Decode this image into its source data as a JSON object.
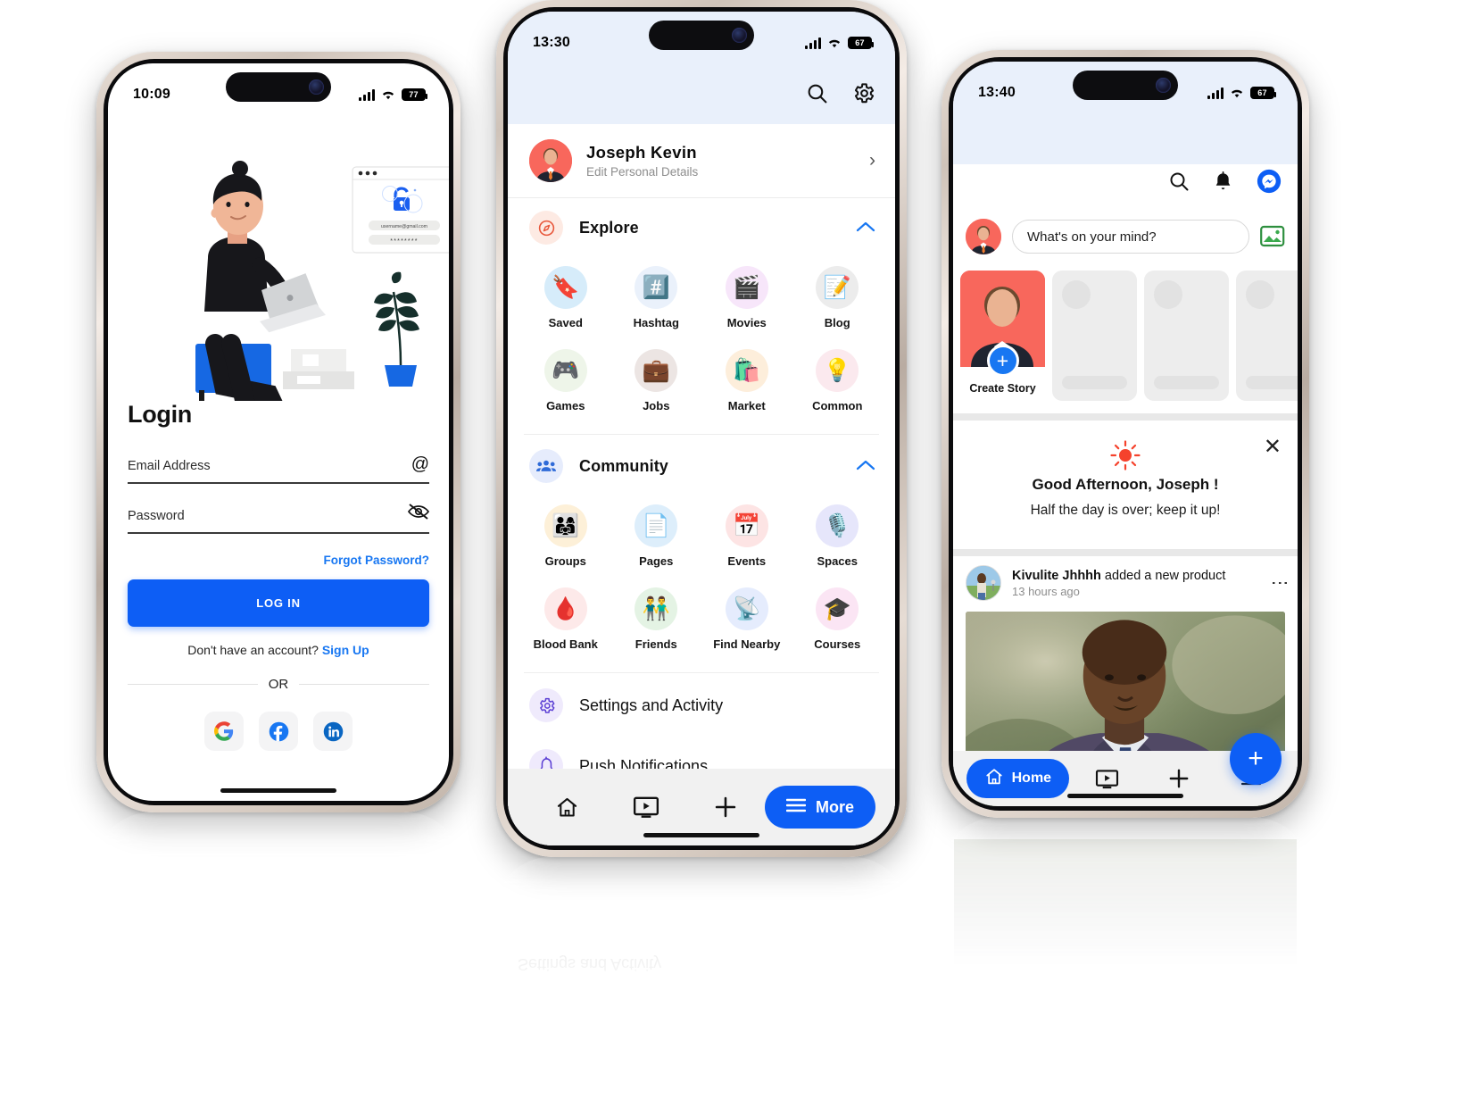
{
  "colors": {
    "primary": "#0d5ef5",
    "link": "#1877f2",
    "status_bar_bg": "#e9f0fb",
    "nav_bg": "#f1f1f1",
    "accent_red": "#f8675c"
  },
  "phone1": {
    "status": {
      "time": "10:09",
      "battery": "77"
    },
    "illustration": {
      "browser_email": "username@gmail.com",
      "browser_password": "********",
      "alt": "person-with-laptop-illustration"
    },
    "title": "Login",
    "email_field": {
      "label": "Email Address",
      "value": "",
      "icon": "at-icon"
    },
    "password_field": {
      "label": "Password",
      "value": "",
      "icon": "eye-off-icon"
    },
    "forgot_password": "Forgot Password?",
    "login_button": "LOG IN",
    "signup_prompt": "Don't have an account? ",
    "signup_link": "Sign Up",
    "or_label": "OR",
    "socials": [
      {
        "name": "google-login-button",
        "icon": "google-icon"
      },
      {
        "name": "facebook-login-button",
        "icon": "facebook-icon"
      },
      {
        "name": "linkedin-login-button",
        "icon": "linkedin-icon"
      }
    ]
  },
  "phone2": {
    "status": {
      "time": "13:30",
      "battery": "67"
    },
    "top_icons": [
      {
        "name": "search-icon",
        "label": "search"
      },
      {
        "name": "gear-icon",
        "label": "settings"
      }
    ],
    "profile": {
      "name": "Joseph  Kevin",
      "subtitle": "Edit Personal Details",
      "chevron": "›"
    },
    "sections": [
      {
        "id": "explore",
        "title": "Explore",
        "icon": "compass-icon",
        "icon_glyph": "🧭",
        "icon_bg": "#fdeae3",
        "collapse_arrow": "⌃",
        "items": [
          {
            "label": "Saved",
            "glyph": "🔖",
            "bg": "#d6ecfa"
          },
          {
            "label": "Hashtag",
            "glyph": "#️⃣",
            "bg": "#eaf1fb"
          },
          {
            "label": "Movies",
            "glyph": "🎬",
            "bg": "#f7e6fa"
          },
          {
            "label": "Blog",
            "glyph": "📝",
            "bg": "#ececec"
          },
          {
            "label": "Games",
            "glyph": "🎮",
            "bg": "#eef5e9"
          },
          {
            "label": "Jobs",
            "glyph": "💼",
            "bg": "#ece5e3"
          },
          {
            "label": "Market",
            "glyph": "🛍️",
            "bg": "#fdeedb"
          },
          {
            "label": "Common",
            "glyph": "💡",
            "bg": "#fbe9ee"
          }
        ]
      },
      {
        "id": "community",
        "title": "Community",
        "icon": "people-icon",
        "icon_glyph": "👥",
        "icon_bg": "#e6ecfc",
        "collapse_arrow": "⌃",
        "items": [
          {
            "label": "Blood Bank",
            "glyph": "🩸",
            "bg": "#fde9e9"
          },
          {
            "label": "Friends",
            "glyph": "👬",
            "bg": "#e4f3e4"
          },
          {
            "label": "Find Nearby",
            "glyph": "📡",
            "bg": "#e5ecfd"
          },
          {
            "label": "Courses",
            "glyph": "🎓",
            "bg": "#fbe5f4"
          },
          {
            "label": "Groups",
            "glyph": "👨‍👩‍👧",
            "bg": "#fdf0d8"
          },
          {
            "label": "Pages",
            "glyph": "📄",
            "bg": "#ddeefb"
          },
          {
            "label": "Events",
            "glyph": "📅",
            "bg": "#fde4e4"
          },
          {
            "label": "Spaces",
            "glyph": "🎙️",
            "bg": "#e6e6fb"
          }
        ]
      }
    ],
    "list_rows": [
      {
        "label": "Settings and Activity",
        "icon": "gear-icon"
      },
      {
        "label": "Push Notifications",
        "icon": "bell-icon"
      }
    ],
    "nav": {
      "items": [
        {
          "name": "nav-home",
          "icon": "home-icon"
        },
        {
          "name": "nav-watch",
          "icon": "video-icon"
        },
        {
          "name": "nav-add",
          "icon": "plus-icon"
        }
      ],
      "more_label": "More",
      "more_icon": "hamburger-icon"
    }
  },
  "phone3": {
    "status": {
      "time": "13:40",
      "battery": "67"
    },
    "top_icons": [
      {
        "name": "search-icon"
      },
      {
        "name": "bell-icon"
      },
      {
        "name": "messenger-icon"
      }
    ],
    "composer": {
      "placeholder": "What's on your mind?",
      "photo_icon": "photo-icon"
    },
    "stories": [
      {
        "label": "Create Story",
        "type": "create",
        "plus": "+"
      },
      {
        "label": "",
        "type": "placeholder"
      },
      {
        "label": "",
        "type": "placeholder"
      },
      {
        "label": "",
        "type": "placeholder"
      }
    ],
    "greeting": {
      "icon": "sun-icon",
      "title": "Good Afternoon, Joseph !",
      "subtitle": "Half the day is over; keep it up!",
      "close": "✕"
    },
    "post": {
      "author": "Kivulite Jhhhh",
      "action": " added a new product",
      "time": "13 hours ago",
      "menu": "⋮",
      "image_alt": "man-in-suit-speaking-photo"
    },
    "fab": "+",
    "nav": {
      "home_label": "Home",
      "home_icon": "home-icon",
      "items": [
        {
          "name": "nav-watch",
          "icon": "video-icon"
        },
        {
          "name": "nav-add",
          "icon": "plus-icon"
        },
        {
          "name": "nav-menu",
          "icon": "hamburger-icon"
        }
      ]
    }
  }
}
